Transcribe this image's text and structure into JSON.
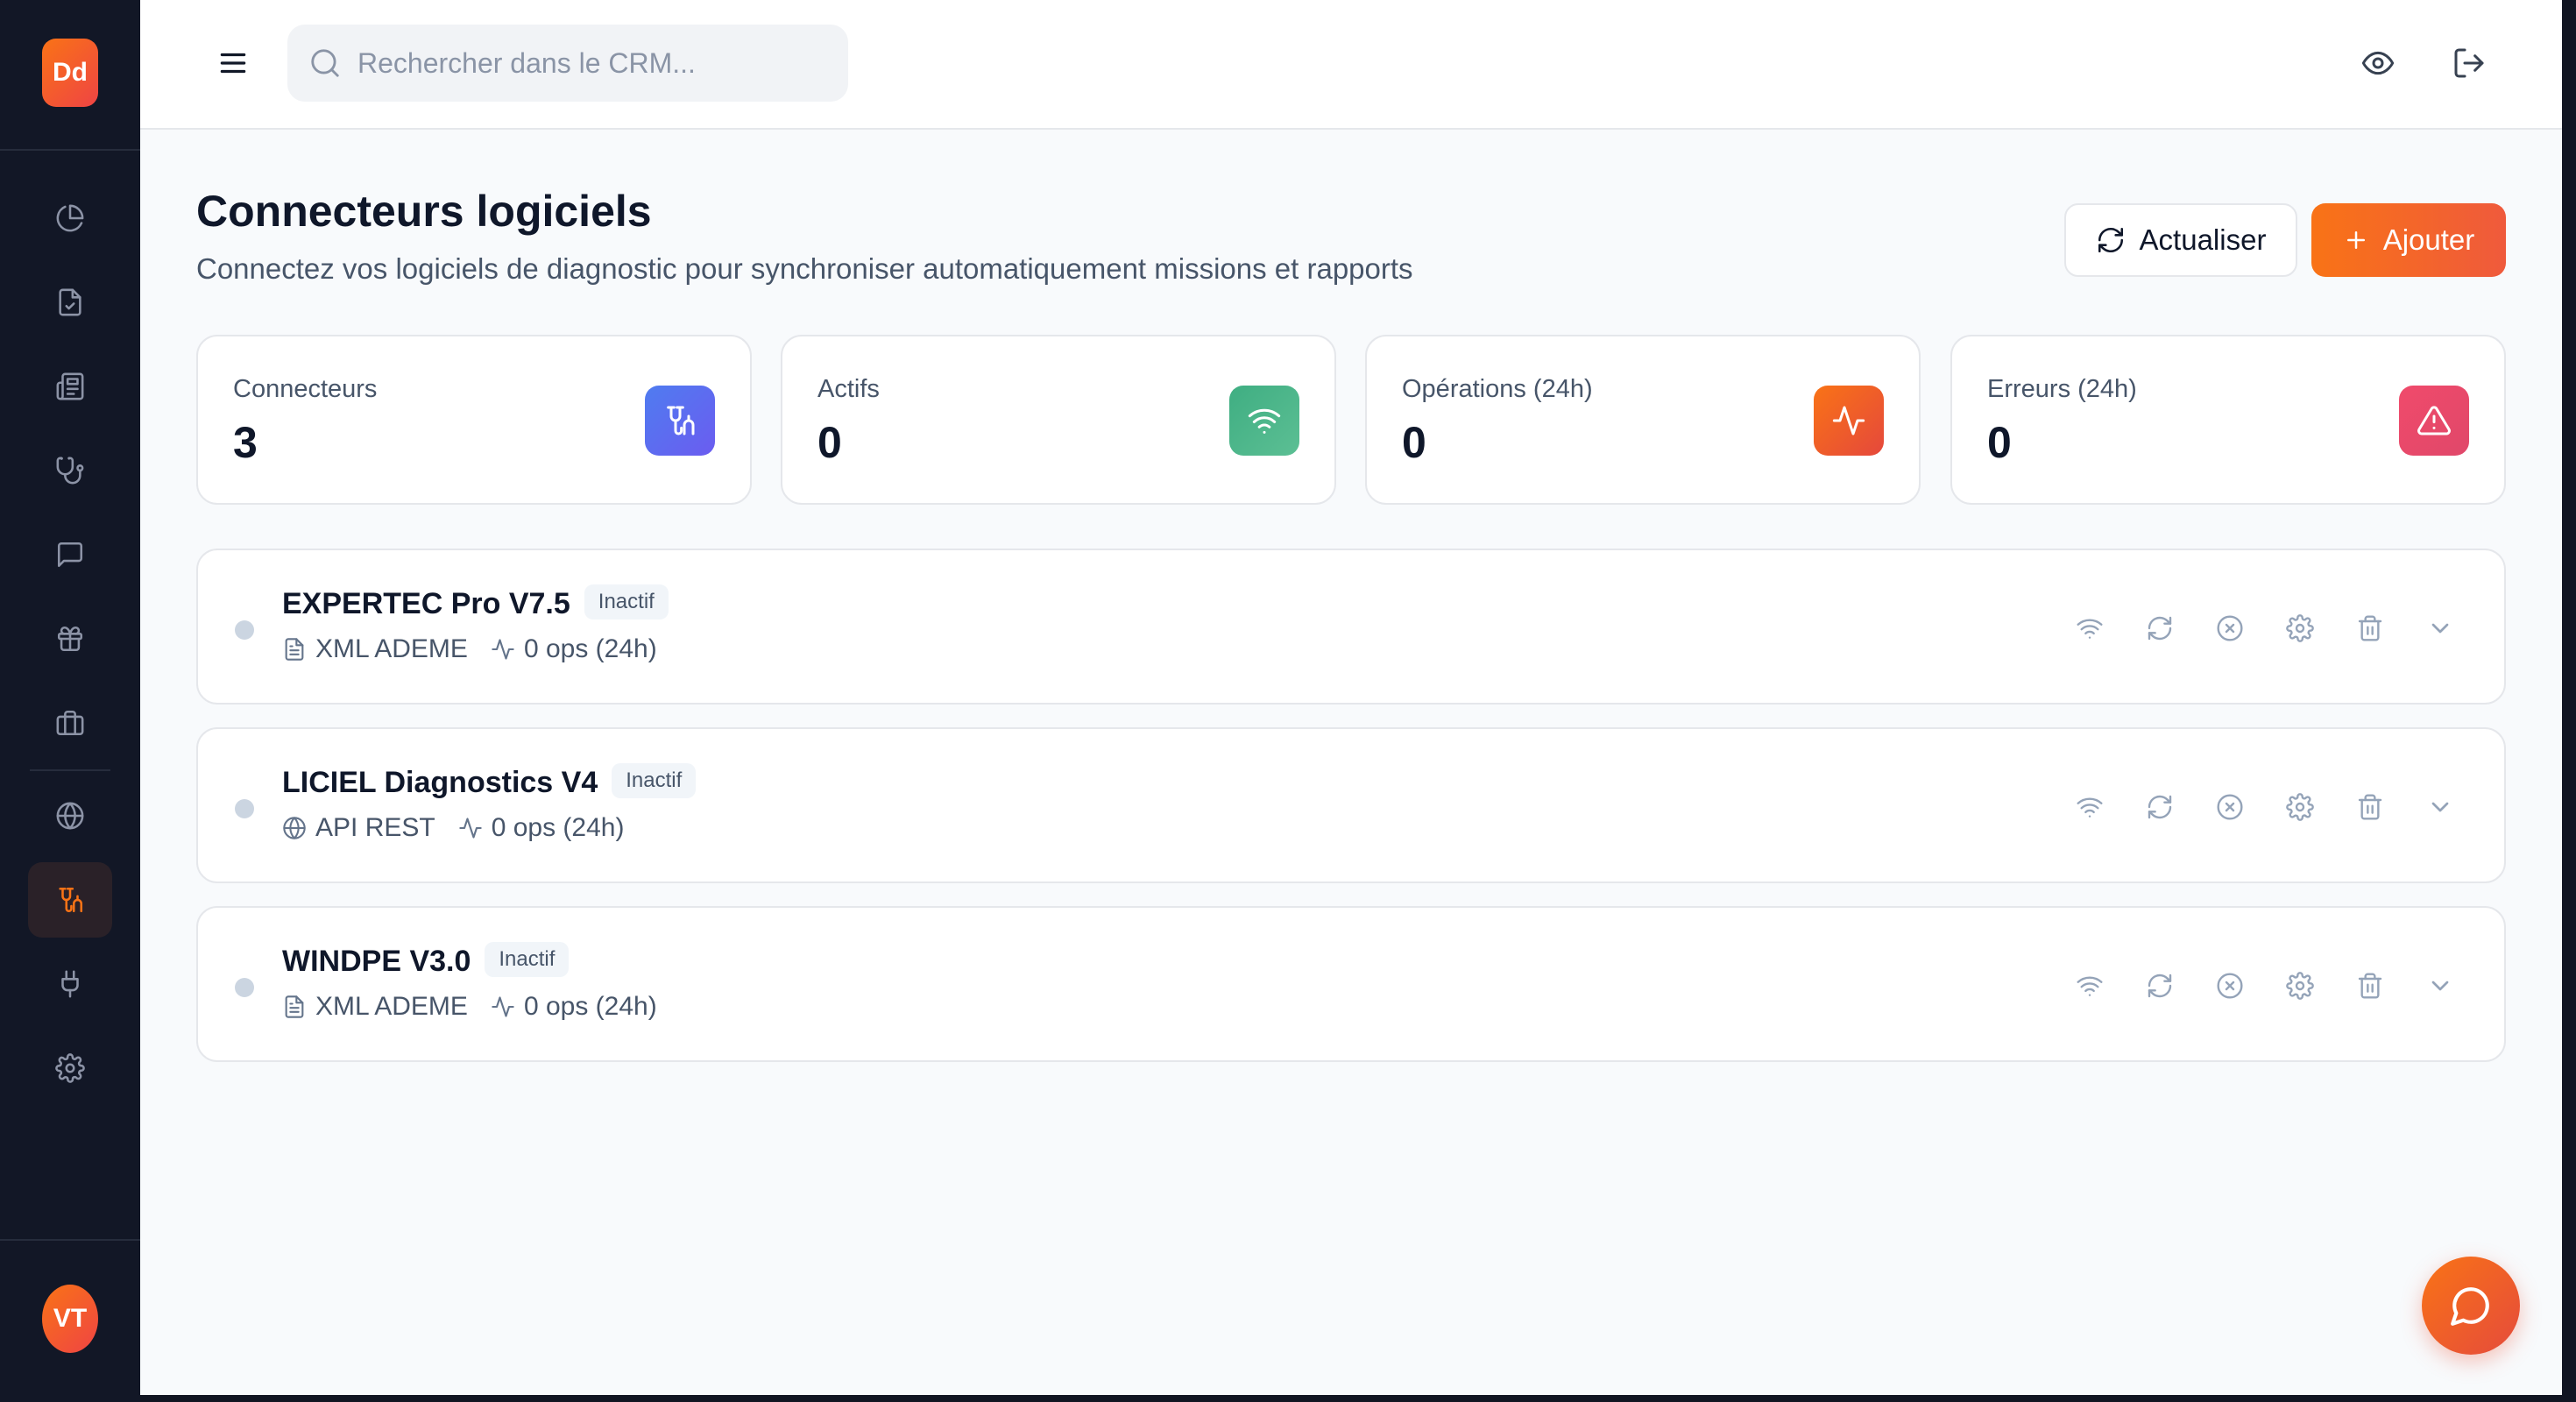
{
  "sidebar": {
    "brand_initials": "Dd",
    "user_initials": "VT",
    "items": [
      {
        "icon": "pie-chart-icon"
      },
      {
        "icon": "file-check-icon"
      },
      {
        "icon": "newspaper-icon"
      },
      {
        "icon": "stethoscope-icon"
      },
      {
        "icon": "message-square-icon"
      },
      {
        "icon": "gift-icon"
      },
      {
        "icon": "briefcase-icon"
      },
      {
        "icon": "globe-icon"
      },
      {
        "icon": "connector-icon",
        "active": true
      },
      {
        "icon": "plug-icon"
      },
      {
        "icon": "settings-icon"
      }
    ]
  },
  "topbar": {
    "search_placeholder": "Rechercher dans le CRM..."
  },
  "header": {
    "title": "Connecteurs logiciels",
    "subtitle": "Connectez vos logiciels de diagnostic pour synchroniser automatiquement missions et rapports",
    "refresh_label": "Actualiser",
    "add_label": "Ajouter"
  },
  "stats": [
    {
      "label": "Connecteurs",
      "value": "3",
      "icon": "connector-icon",
      "color": "#5b6cf0"
    },
    {
      "label": "Actifs",
      "value": "0",
      "icon": "wifi-icon",
      "color": "#4cb38a"
    },
    {
      "label": "Opérations (24h)",
      "value": "0",
      "icon": "activity-icon",
      "color": "#ef5a3c"
    },
    {
      "label": "Erreurs (24h)",
      "value": "0",
      "icon": "alert-triangle-icon",
      "color": "#e5486a"
    }
  ],
  "connectors": [
    {
      "name": "EXPERTEC Pro V7.5",
      "status": "Inactif",
      "format": "XML ADEME",
      "format_icon": "file-icon",
      "ops": "0 ops (24h)"
    },
    {
      "name": "LICIEL Diagnostics V4",
      "status": "Inactif",
      "format": "API REST",
      "format_icon": "globe-icon",
      "ops": "0 ops (24h)"
    },
    {
      "name": "WINDPE V3.0",
      "status": "Inactif",
      "format": "XML ADEME",
      "format_icon": "file-icon",
      "ops": "0 ops (24h)"
    }
  ],
  "colors": {
    "accent": "#f97316",
    "sidebar_bg": "#121726",
    "status_inactive": "#cbd5e1"
  }
}
